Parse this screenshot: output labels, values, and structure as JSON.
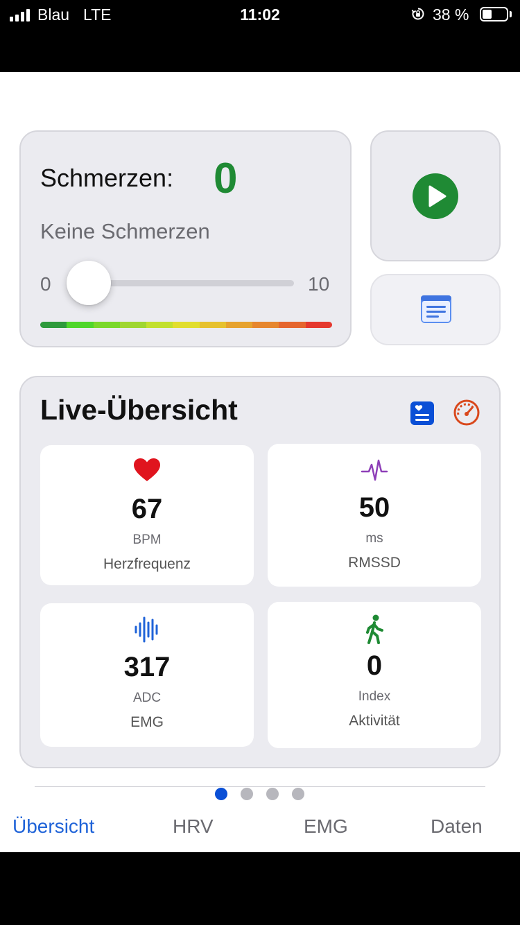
{
  "status_bar": {
    "carrier": "Blau",
    "network": "LTE",
    "time": "11:02",
    "battery_percent": "38 %",
    "battery_level": 0.38,
    "icons": [
      "signal-bars-icon",
      "rotation-lock-icon",
      "battery-icon"
    ]
  },
  "pain": {
    "label": "Schmerzen:",
    "value": "0",
    "description": "Keine Schmerzen",
    "slider_min": "0",
    "slider_max": "10",
    "slider_value": 0,
    "scale_colors": [
      "#2e9a3c",
      "#4fd62a",
      "#7ad82a",
      "#9fd630",
      "#c2e02e",
      "#e1de2e",
      "#e6c12e",
      "#e6a22e",
      "#e6862e",
      "#e5652e",
      "#e5382e"
    ]
  },
  "side_buttons": {
    "start_icon": "play-icon",
    "notes_icon": "note-icon"
  },
  "live": {
    "title": "Live-Übersicht",
    "header_icons": [
      "heart-card-icon",
      "speedometer-icon"
    ],
    "metrics": [
      {
        "icon": "heart-icon",
        "value": "67",
        "unit": "BPM",
        "label": "Herzfrequenz"
      },
      {
        "icon": "waveform-icon",
        "value": "50",
        "unit": "ms",
        "label": "RMSSD"
      },
      {
        "icon": "audio-waveform-icon",
        "value": "317",
        "unit": "ADC",
        "label": "EMG"
      },
      {
        "icon": "walking-icon",
        "value": "0",
        "unit": "Index",
        "label": "Aktivität"
      }
    ]
  },
  "pager": {
    "count": 4,
    "active_index": 0
  },
  "tabs": [
    {
      "label": "Übersicht",
      "active": true
    },
    {
      "label": "HRV",
      "active": false
    },
    {
      "label": "EMG",
      "active": false
    },
    {
      "label": "Daten",
      "active": false
    }
  ],
  "colors": {
    "accent_green": "#1f8a34",
    "accent_blue": "#1f63d8",
    "heart_red": "#e0141e",
    "hrv_purple": "#8e3fb8",
    "emg_blue": "#1f63d8",
    "activity_green": "#1f8a34",
    "speedometer_orange": "#d9481c"
  }
}
